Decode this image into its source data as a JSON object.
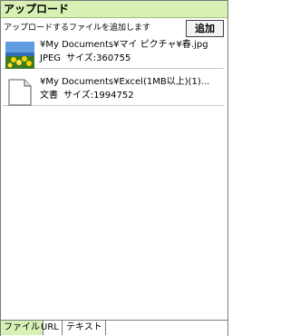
{
  "window": {
    "title": "アップロード"
  },
  "toolbar": {
    "hint": "アップロードするファイルを追加します",
    "add_label": "追加"
  },
  "files": [
    {
      "path": "¥My Documents¥マイ ピクチャ¥春.jpg",
      "type": "JPEG",
      "size_label": "サイズ:360755",
      "icon": "jpeg-thumbnail-icon"
    },
    {
      "path": "¥My Documents¥Excel(1MB以上)(1)...",
      "type": "文書",
      "size_label": "サイズ:1994752",
      "icon": "document-icon"
    }
  ],
  "tabs": [
    {
      "label": "ファイル",
      "active": true
    },
    {
      "label": "URL",
      "active": false
    },
    {
      "label": "テキスト",
      "active": false
    }
  ]
}
